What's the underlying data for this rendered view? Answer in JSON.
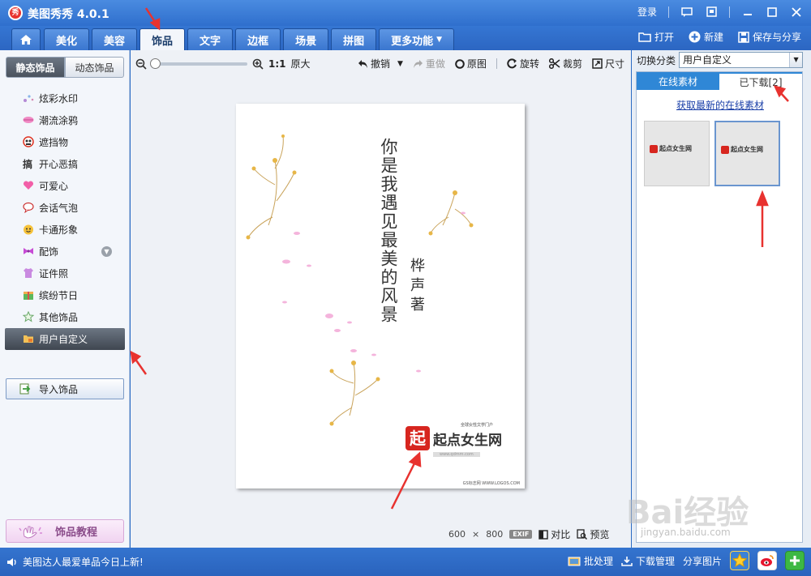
{
  "app": {
    "title": "美图秀秀 4.0.1",
    "logo_char": "秀"
  },
  "titlebar": {
    "login": "登录"
  },
  "tabs": [
    {
      "label": "美化"
    },
    {
      "label": "美容"
    },
    {
      "label": "饰品"
    },
    {
      "label": "文字"
    },
    {
      "label": "边框"
    },
    {
      "label": "场景"
    },
    {
      "label": "拼图"
    },
    {
      "label": "更多功能"
    }
  ],
  "actions": {
    "open": "打开",
    "new": "新建",
    "save_share": "保存与分享"
  },
  "left": {
    "subtabs": [
      "静态饰品",
      "动态饰品"
    ],
    "categories": [
      {
        "label": "炫彩水印"
      },
      {
        "label": "潮流涂鸦"
      },
      {
        "label": "遮挡物"
      },
      {
        "label": "开心恶搞"
      },
      {
        "label": "可爱心"
      },
      {
        "label": "会话气泡"
      },
      {
        "label": "卡通形象"
      },
      {
        "label": "配饰"
      },
      {
        "label": "证件照"
      },
      {
        "label": "缤纷节日"
      },
      {
        "label": "其他饰品"
      },
      {
        "label": "用户自定义"
      }
    ],
    "import_label": "导入饰品",
    "tutorial_label": "饰品教程"
  },
  "toolbar": {
    "zoom_ratio": "1:1",
    "zoom_original": "原大",
    "undo": "撤销",
    "redo": "重做",
    "original": "原图",
    "rotate": "旋转",
    "crop": "裁剪",
    "size": "尺寸"
  },
  "canvas": {
    "poem": "你是我遇见最美的风景",
    "author": "桦声著",
    "logo_text": "起点女生网",
    "logo_mark": "起",
    "logo_sub": "全球女性文学门户",
    "logo_url": "www.qdmm.com",
    "footer": "GS标志网 WWW.LOGOS.COM"
  },
  "image_info": {
    "width": "600",
    "times": "×",
    "height": "800",
    "exif": "EXIF",
    "compare": "对比",
    "preview": "预览"
  },
  "right": {
    "switch_label": "切换分类",
    "switch_value": "用户自定义",
    "tabs": [
      "在线素材",
      "已下载[2]"
    ],
    "fetch_link": "获取最新的在线素材",
    "thumbs": [
      {
        "text": "起点女生网"
      },
      {
        "text": "起点女生网"
      }
    ]
  },
  "status": {
    "message": "美图达人最爱单品今日上新!",
    "batch": "批处理",
    "download": "下载管理",
    "share": "分享图片"
  },
  "watermark": {
    "brand": "Bai经验",
    "url": "jingyan.baidu.com"
  },
  "colors": {
    "brand_blue": "#2f6fcd",
    "accent_red": "#e8322f",
    "link": "#1a3fa8"
  }
}
